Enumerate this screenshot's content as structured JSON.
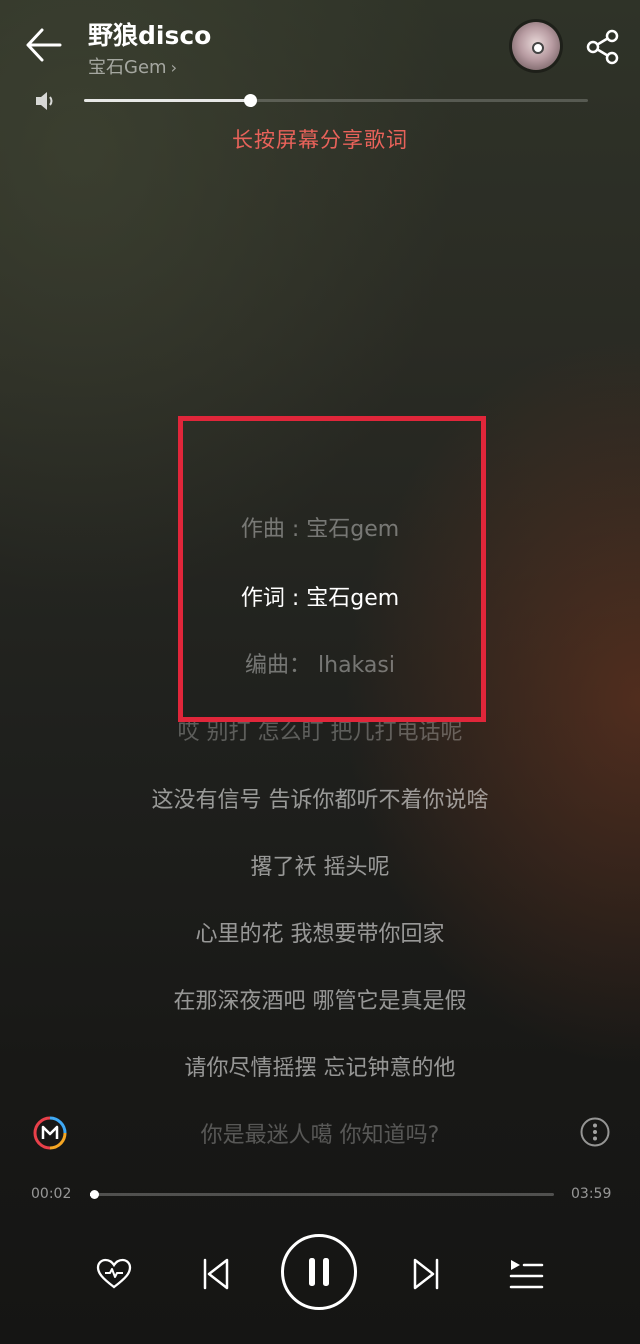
{
  "header": {
    "title": "野狼disco",
    "artist": "宝石Gem",
    "artist_chevron": "›"
  },
  "volume": {
    "level": 0.33
  },
  "hint": "长按屏幕分享歌词",
  "lyrics": [
    {
      "text": "作曲 : 宝石gem",
      "state": "past"
    },
    {
      "text": "作词 : 宝石gem",
      "state": "current"
    },
    {
      "text": "编曲： lhakasi",
      "state": "upcoming"
    },
    {
      "text": "哎 别打 怎么盯 把几打电话呢",
      "state": "upcoming"
    },
    {
      "text": "这没有信号 告诉你都听不着你说啥",
      "state": "upcoming"
    },
    {
      "text": "撂了袄 摇头呢",
      "state": "upcoming"
    },
    {
      "text": "心里的花 我想要带你回家",
      "state": "upcoming"
    },
    {
      "text": "在那深夜酒吧 哪管它是真是假",
      "state": "upcoming"
    },
    {
      "text": "请你尽情摇摆 忘记钟意的他",
      "state": "upcoming"
    },
    {
      "text": "你是最迷人噶 你知道吗?",
      "state": "upcoming"
    }
  ],
  "playback": {
    "elapsed": "00:02",
    "duration": "03:59",
    "progress": 0.008
  },
  "icons": {
    "back": "back-arrow-icon",
    "share": "share-icon",
    "volume": "speaker-icon",
    "like": "heart-icon",
    "prev": "previous-icon",
    "pause": "pause-icon",
    "next": "next-icon",
    "playlist": "playlist-icon",
    "more": "more-icon",
    "logo": "m-logo-icon"
  },
  "colors": {
    "hint": "#e8625a",
    "highlight_box": "#e0263a"
  }
}
